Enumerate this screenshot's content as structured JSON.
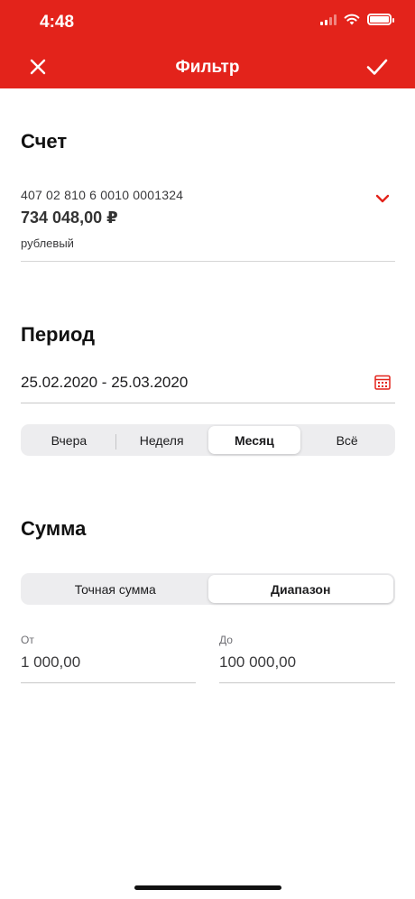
{
  "status_bar": {
    "time": "4:48"
  },
  "nav": {
    "title": "Фильтр",
    "close_icon": "close-icon",
    "done_icon": "checkmark-icon"
  },
  "account_section": {
    "title": "Счет",
    "number": "407 02 810 6 0010 0001324",
    "balance": "734 048,00 ₽",
    "currency": "рублевый"
  },
  "period_section": {
    "title": "Период",
    "value": "25.02.2020 - 25.03.2020",
    "options": [
      "Вчера",
      "Неделя",
      "Месяц",
      "Всё"
    ],
    "selected": "Месяц"
  },
  "amount_section": {
    "title": "Сумма",
    "modes": [
      "Точная сумма",
      "Диапазон"
    ],
    "selected": "Диапазон",
    "from_label": "От",
    "from_value": "1 000,00",
    "to_label": "До",
    "to_value": "100 000,00"
  },
  "colors": {
    "accent": "#e3231b",
    "background": "#ffffff",
    "segment_bg": "#ededef"
  }
}
